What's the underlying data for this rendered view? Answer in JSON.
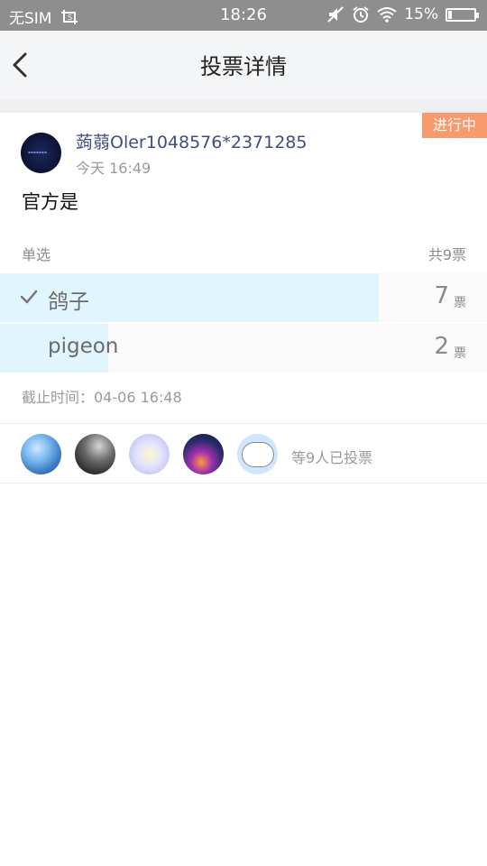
{
  "status_bar": {
    "carrier": "无SIM",
    "time": "18:26",
    "battery_percent": "15%",
    "battery_level": 0.15
  },
  "nav": {
    "title": "投票详情",
    "back_icon": "chevron-left-icon"
  },
  "post": {
    "status_tag": "进行中",
    "author": "蒟蒻Oler1048576*2371285",
    "time": "今天 16:49",
    "question": "官方是",
    "vote_type": "单选",
    "total_votes": "共9票",
    "options": [
      {
        "label": "鸽子",
        "count": "7",
        "unit": "票",
        "fraction": 0.778,
        "selected": true
      },
      {
        "label": "pigeon",
        "count": "2",
        "unit": "票",
        "fraction": 0.222,
        "selected": false
      }
    ],
    "deadline": "截止时间：04-06 16:48"
  },
  "voters": {
    "summary": "等9人已投票"
  },
  "colors": {
    "status_bar_bg": "#8e8e8e",
    "nav_bg": "#f4f5f7",
    "author_name": "#3d4f7f",
    "status_tag": "#f99a6d",
    "vote_bar": "#e1f5fe"
  }
}
